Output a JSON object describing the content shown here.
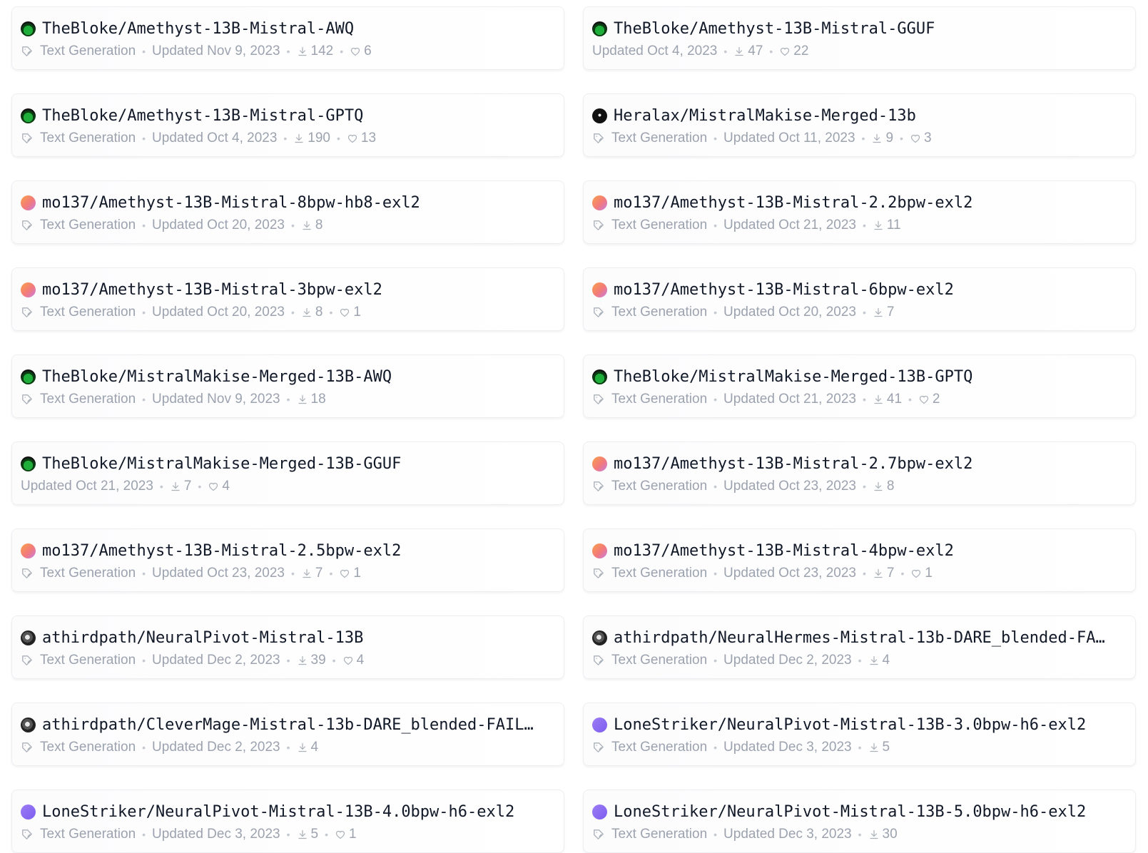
{
  "models": [
    {
      "name": "TheBloke/Amethyst-13B-Mistral-AWQ",
      "avatar": "green",
      "task": "Text Generation",
      "updated": "Updated Nov 9, 2023",
      "downloads": "142",
      "likes": "6"
    },
    {
      "name": "TheBloke/Amethyst-13B-Mistral-GGUF",
      "avatar": "green",
      "task": "",
      "updated": "Updated Oct 4, 2023",
      "downloads": "47",
      "likes": "22"
    },
    {
      "name": "TheBloke/Amethyst-13B-Mistral-GPTQ",
      "avatar": "green",
      "task": "Text Generation",
      "updated": "Updated Oct 4, 2023",
      "downloads": "190",
      "likes": "13"
    },
    {
      "name": "Heralax/MistralMakise-Merged-13b",
      "avatar": "dark",
      "task": "Text Generation",
      "updated": "Updated Oct 11, 2023",
      "downloads": "9",
      "likes": "3"
    },
    {
      "name": "mo137/Amethyst-13B-Mistral-8bpw-hb8-exl2",
      "avatar": "orange",
      "task": "Text Generation",
      "updated": "Updated Oct 20, 2023",
      "downloads": "8",
      "likes": ""
    },
    {
      "name": "mo137/Amethyst-13B-Mistral-2.2bpw-exl2",
      "avatar": "orange",
      "task": "Text Generation",
      "updated": "Updated Oct 21, 2023",
      "downloads": "11",
      "likes": ""
    },
    {
      "name": "mo137/Amethyst-13B-Mistral-3bpw-exl2",
      "avatar": "orange",
      "task": "Text Generation",
      "updated": "Updated Oct 20, 2023",
      "downloads": "8",
      "likes": "1"
    },
    {
      "name": "mo137/Amethyst-13B-Mistral-6bpw-exl2",
      "avatar": "orange",
      "task": "Text Generation",
      "updated": "Updated Oct 20, 2023",
      "downloads": "7",
      "likes": ""
    },
    {
      "name": "TheBloke/MistralMakise-Merged-13B-AWQ",
      "avatar": "green",
      "task": "Text Generation",
      "updated": "Updated Nov 9, 2023",
      "downloads": "18",
      "likes": ""
    },
    {
      "name": "TheBloke/MistralMakise-Merged-13B-GPTQ",
      "avatar": "green",
      "task": "Text Generation",
      "updated": "Updated Oct 21, 2023",
      "downloads": "41",
      "likes": "2"
    },
    {
      "name": "TheBloke/MistralMakise-Merged-13B-GGUF",
      "avatar": "green",
      "task": "",
      "updated": "Updated Oct 21, 2023",
      "downloads": "7",
      "likes": "4"
    },
    {
      "name": "mo137/Amethyst-13B-Mistral-2.7bpw-exl2",
      "avatar": "orange",
      "task": "Text Generation",
      "updated": "Updated Oct 23, 2023",
      "downloads": "8",
      "likes": ""
    },
    {
      "name": "mo137/Amethyst-13B-Mistral-2.5bpw-exl2",
      "avatar": "orange",
      "task": "Text Generation",
      "updated": "Updated Oct 23, 2023",
      "downloads": "7",
      "likes": "1"
    },
    {
      "name": "mo137/Amethyst-13B-Mistral-4bpw-exl2",
      "avatar": "orange",
      "task": "Text Generation",
      "updated": "Updated Oct 23, 2023",
      "downloads": "7",
      "likes": "1"
    },
    {
      "name": "athirdpath/NeuralPivot-Mistral-13B",
      "avatar": "mono",
      "task": "Text Generation",
      "updated": "Updated Dec 2, 2023",
      "downloads": "39",
      "likes": "4"
    },
    {
      "name": "athirdpath/NeuralHermes-Mistral-13b-DARE_blended-FA…",
      "avatar": "mono",
      "task": "Text Generation",
      "updated": "Updated Dec 2, 2023",
      "downloads": "4",
      "likes": ""
    },
    {
      "name": "athirdpath/CleverMage-Mistral-13b-DARE_blended-FAIL…",
      "avatar": "mono",
      "task": "Text Generation",
      "updated": "Updated Dec 2, 2023",
      "downloads": "4",
      "likes": ""
    },
    {
      "name": "LoneStriker/NeuralPivot-Mistral-13B-3.0bpw-h6-exl2",
      "avatar": "purple",
      "task": "Text Generation",
      "updated": "Updated Dec 3, 2023",
      "downloads": "5",
      "likes": ""
    },
    {
      "name": "LoneStriker/NeuralPivot-Mistral-13B-4.0bpw-h6-exl2",
      "avatar": "purple",
      "task": "Text Generation",
      "updated": "Updated Dec 3, 2023",
      "downloads": "5",
      "likes": "1"
    },
    {
      "name": "LoneStriker/NeuralPivot-Mistral-13B-5.0bpw-h6-exl2",
      "avatar": "purple",
      "task": "Text Generation",
      "updated": "Updated Dec 3, 2023",
      "downloads": "30",
      "likes": ""
    }
  ]
}
